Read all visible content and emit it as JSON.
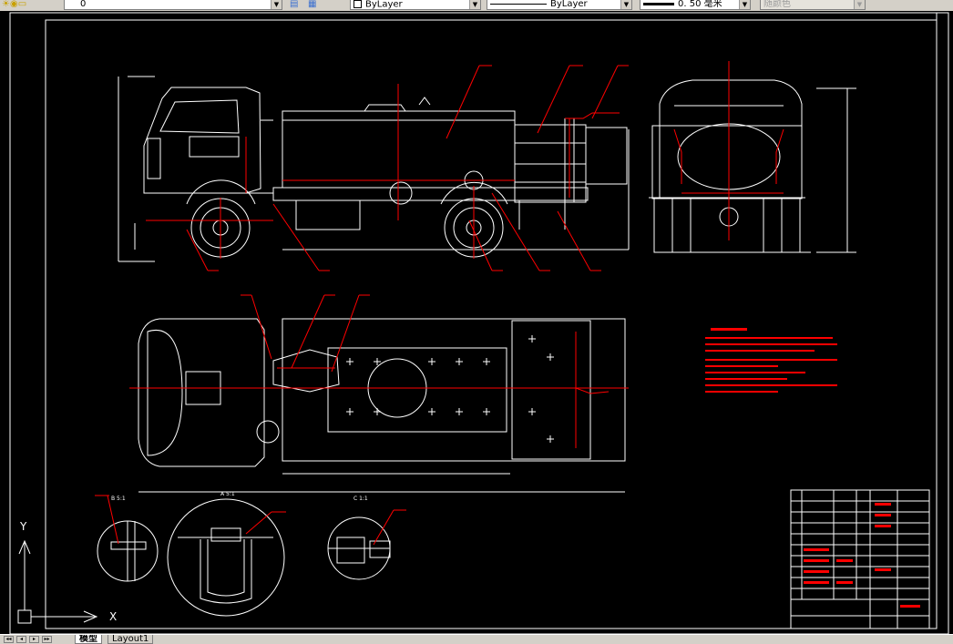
{
  "toolbar": {
    "layer_value": "0",
    "color_combo": "ByLayer",
    "linetype_combo": "ByLayer",
    "lineweight_combo": "0. 50 毫米",
    "plotstyle_combo": "随颜色"
  },
  "tabs": {
    "model": "模型",
    "layout1": "Layout1"
  },
  "drawing": {
    "detail_b_title": "B  5:1",
    "detail_a_title": "A  5:1",
    "detail_c_title": "C  1:1",
    "ucs_x": "X",
    "ucs_y": "Y"
  },
  "colors": {
    "canvas_bg": "#000000",
    "drawing_lines": "#ffffff",
    "leader_red": "#ff0000",
    "toolbar_bg": "#d4d0c8"
  }
}
